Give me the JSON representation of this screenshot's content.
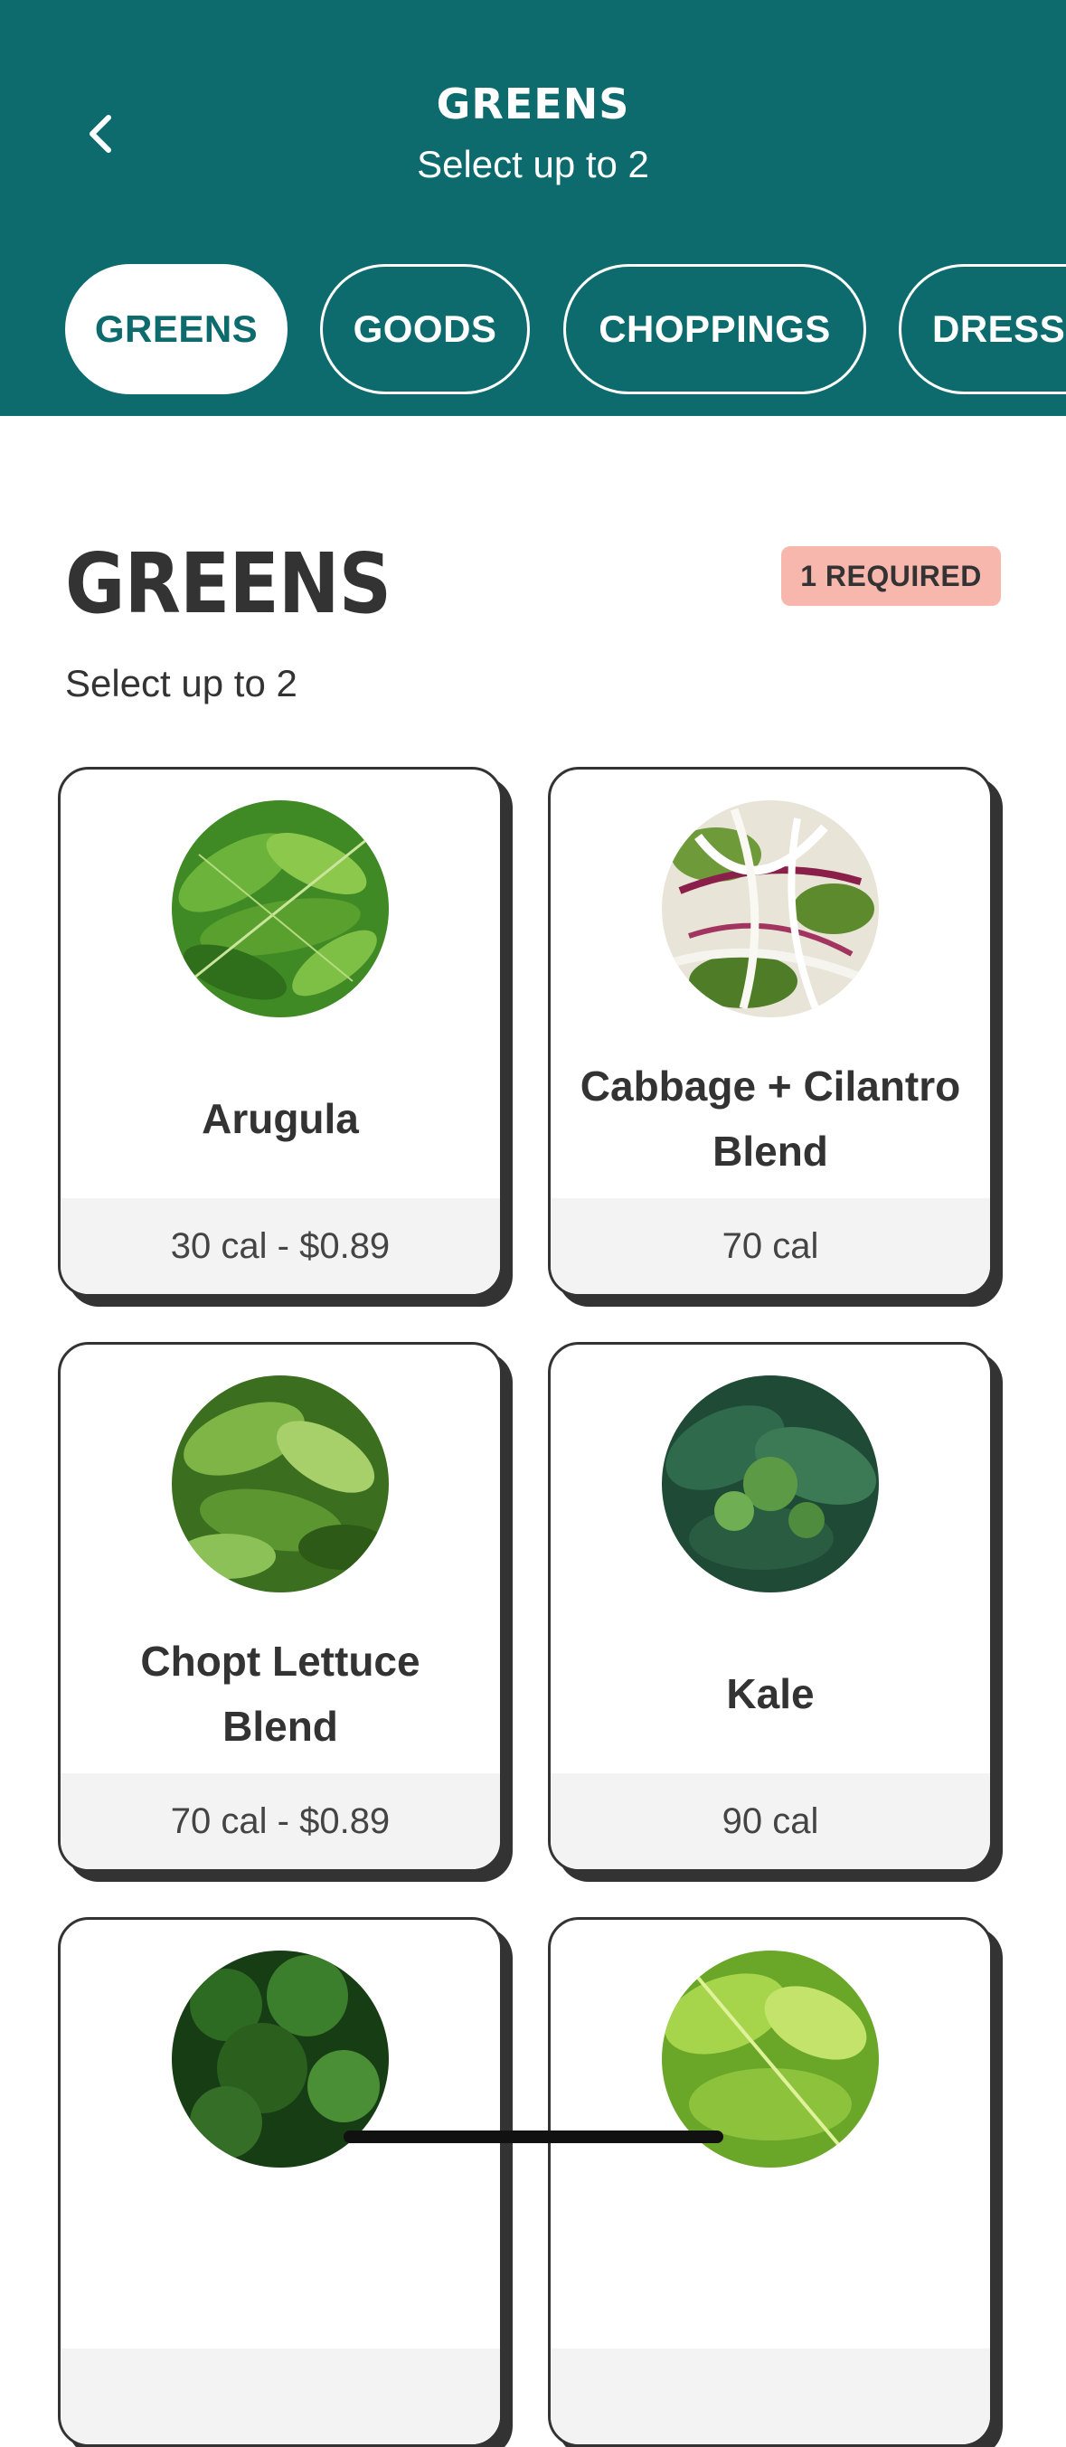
{
  "header": {
    "title": "GREENS",
    "subtitle": "Select up to 2",
    "back_icon": "chevron-left-icon"
  },
  "tabs": [
    {
      "label": "GREENS",
      "active": true
    },
    {
      "label": "GOODS",
      "active": false
    },
    {
      "label": "CHOPPINGS",
      "active": false
    },
    {
      "label": "DRESSINGS",
      "active": false
    }
  ],
  "section": {
    "title": "GREENS",
    "badge": "1 REQUIRED",
    "subtitle": "Select up to 2"
  },
  "items": [
    {
      "name": "Arugula",
      "price": "30 cal - $0.89"
    },
    {
      "name": "Cabbage + Cilantro Blend",
      "price": "70 cal"
    },
    {
      "name": "Chopt Lettuce Blend",
      "price": "70 cal - $0.89"
    },
    {
      "name": "Kale",
      "price": "90 cal"
    },
    {
      "name": "",
      "price": ""
    },
    {
      "name": "",
      "price": ""
    }
  ],
  "colors": {
    "brand": "#0d6b6e",
    "badge": "#f7b7ad",
    "text": "#333333"
  }
}
